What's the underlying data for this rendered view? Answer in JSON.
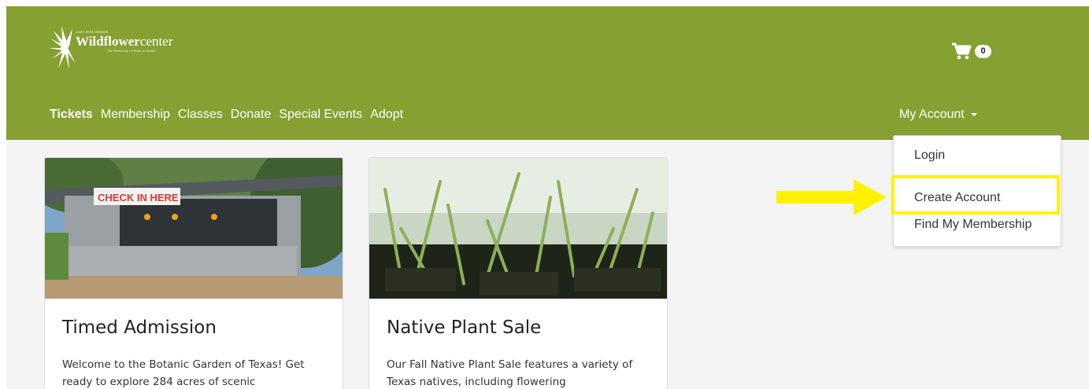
{
  "header": {
    "logo": {
      "small": "Lady Bird Johnson",
      "main_bold": "Wildflower",
      "main_rest": "center",
      "sub": "The University of Texas at Austin"
    },
    "cart_count": "0",
    "nav": [
      "Tickets",
      "Membership",
      "Classes",
      "Donate",
      "Special Events",
      "Adopt"
    ],
    "account_label": "My Account"
  },
  "dropdown": {
    "items": [
      "Login",
      "Create Account",
      "Find My Membership"
    ]
  },
  "cards": [
    {
      "title": "Timed Admission",
      "text": "Welcome to the Botanic Garden of Texas! Get ready to explore 284 acres of scenic",
      "sign": "CHECK IN HERE"
    },
    {
      "title": "Native Plant Sale",
      "text": "Our Fall Native Plant Sale features a variety of Texas natives, including flowering"
    }
  ],
  "colors": {
    "header": "#86a031",
    "highlight": "#fff200"
  }
}
